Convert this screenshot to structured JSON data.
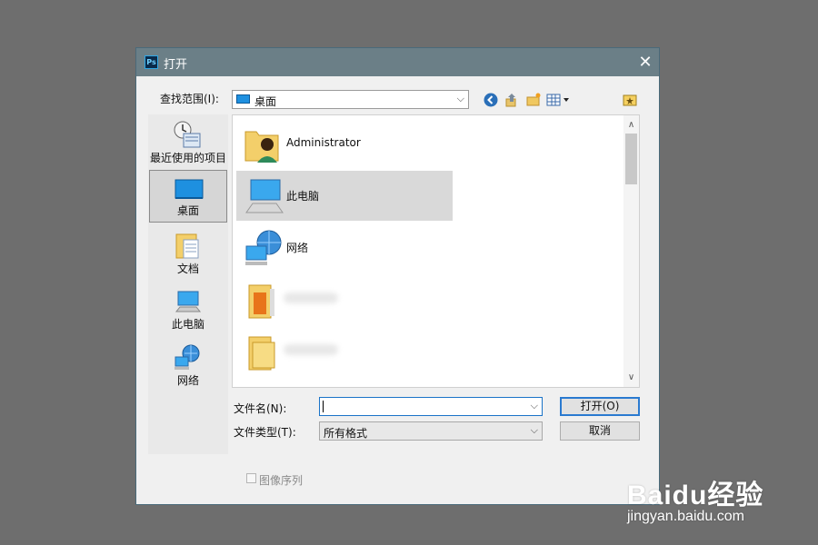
{
  "window": {
    "title": "打开",
    "app_icon_text": "Ps",
    "close_glyph": "✕"
  },
  "lookin": {
    "label": "查找范围(I):",
    "value": "桌面",
    "arrow_glyph": "⌵"
  },
  "toolbar": {
    "icons": [
      "back-icon",
      "up-folder-icon",
      "new-folder-icon",
      "view-menu-icon",
      "favorites-icon"
    ]
  },
  "places": [
    {
      "label": "最近使用的项目",
      "icon": "recent-items-icon"
    },
    {
      "label": "桌面",
      "icon": "desktop-icon",
      "selected": true
    },
    {
      "label": "文档",
      "icon": "documents-icon"
    },
    {
      "label": "此电脑",
      "icon": "this-pc-icon"
    },
    {
      "label": "网络",
      "icon": "network-icon"
    }
  ],
  "files": [
    {
      "name": "Administrator",
      "icon": "user-folder-icon"
    },
    {
      "name": "此电脑",
      "icon": "computer-icon",
      "selected": true
    },
    {
      "name": "网络",
      "icon": "network-icon"
    },
    {
      "name": "",
      "icon": "app-folder-icon"
    },
    {
      "name": "",
      "icon": "folder-icon"
    }
  ],
  "filename": {
    "label": "文件名(N):",
    "value": ""
  },
  "filetype": {
    "label": "文件类型(T):",
    "value": "所有格式"
  },
  "buttons": {
    "open": "打开(O)",
    "cancel": "取消"
  },
  "image_sequence": {
    "label": "图像序列",
    "checked": false
  },
  "watermark": {
    "logo": "Baidu经验",
    "url": "jingyan.baidu.com"
  },
  "colors": {
    "titlebar": "#6b7f87",
    "selection": "#d9d9d9",
    "focus_border": "#1a73c8"
  }
}
